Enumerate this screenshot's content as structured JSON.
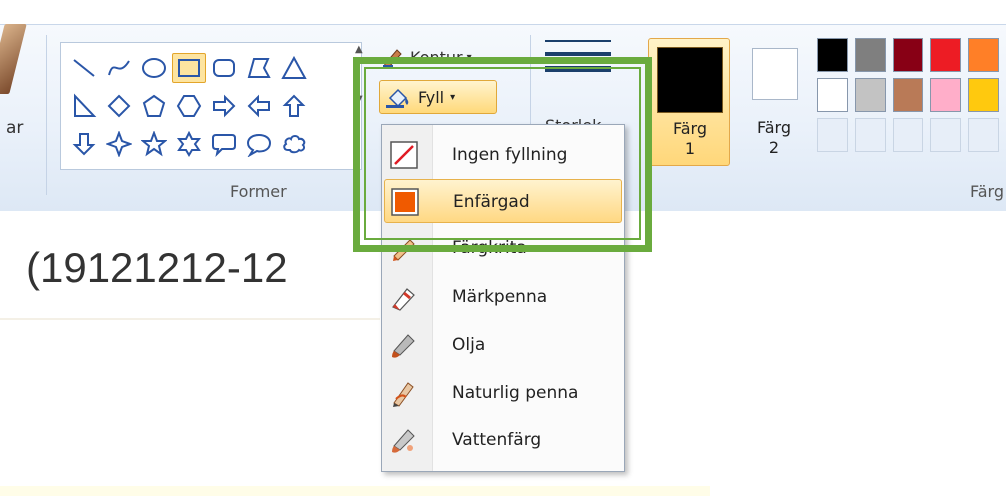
{
  "ribbon": {
    "left_tool_label_partial": "ar",
    "shapes_group_label": "Former",
    "kontur_label": "Kontur",
    "fyll_label": "Fyll",
    "storlek_label_partial": "Storlek",
    "farg1_label": "Färg\n1",
    "farg2_label": "Färg\n2",
    "colors_group_label_partial": "Färg",
    "shapes": [
      [
        "line-shape",
        "curve-shape",
        "oval-shape",
        "rectangle-shape",
        "rounded-rectangle-shape",
        "polygon-shape",
        "triangle-shape"
      ],
      [
        "right-triangle-shape",
        "diamond-shape",
        "pentagon-shape",
        "hexagon-shape",
        "right-arrow-shape",
        "left-arrow-shape",
        "up-arrow-shape"
      ],
      [
        "down-arrow-shape",
        "four-point-star-shape",
        "five-point-star-shape",
        "six-point-star-shape",
        "rounded-callout-shape",
        "oval-callout-shape",
        "cloud-callout-shape"
      ]
    ],
    "selected_shape": "rectangle-shape",
    "palette_colors": [
      [
        "#000000",
        "#7f7f7f",
        "#880015",
        "#ed1c24",
        "#ff7f27"
      ],
      [
        "#ffffff",
        "#c3c3c3",
        "#b97a57",
        "#ffaec9",
        "#ffc90e"
      ],
      [
        "",
        "",
        "",
        "",
        ""
      ]
    ],
    "color1_value": "#000000",
    "color2_value": "#ffffff"
  },
  "fill_menu": {
    "items": [
      {
        "label": "Ingen fyllning",
        "icon": "no-fill-icon"
      },
      {
        "label": "Enfärgad",
        "icon": "solid-color-icon",
        "highlighted": true
      },
      {
        "label": "Färgkrita",
        "icon": "crayon-icon"
      },
      {
        "label": "Märkpenna",
        "icon": "marker-icon"
      },
      {
        "label": "Olja",
        "icon": "oil-brush-icon"
      },
      {
        "label": "Naturlig penna",
        "icon": "natural-pencil-icon"
      },
      {
        "label": "Vattenfärg",
        "icon": "watercolor-icon"
      }
    ]
  },
  "canvas": {
    "text": "(19121212-12"
  },
  "colors": {
    "accent_highlight": "#6aab3e",
    "solid_fill_swatch": "#f05a00"
  }
}
